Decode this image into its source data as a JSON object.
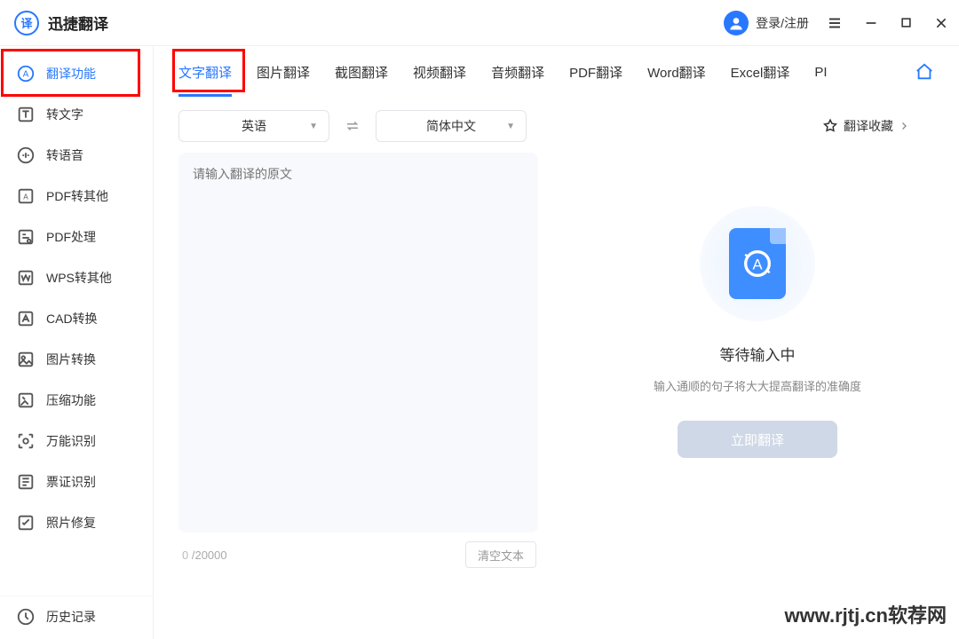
{
  "header": {
    "app_title": "迅捷翻译",
    "login_text": "登录/注册"
  },
  "sidebar": {
    "items": [
      {
        "label": "翻译功能"
      },
      {
        "label": "转文字"
      },
      {
        "label": "转语音"
      },
      {
        "label": "PDF转其他"
      },
      {
        "label": "PDF处理"
      },
      {
        "label": "WPS转其他"
      },
      {
        "label": "CAD转换"
      },
      {
        "label": "图片转换"
      },
      {
        "label": "压缩功能"
      },
      {
        "label": "万能识别"
      },
      {
        "label": "票证识别"
      },
      {
        "label": "照片修复"
      }
    ],
    "history_label": "历史记录"
  },
  "tabs": [
    {
      "label": "文字翻译"
    },
    {
      "label": "图片翻译"
    },
    {
      "label": "截图翻译"
    },
    {
      "label": "视频翻译"
    },
    {
      "label": "音频翻译"
    },
    {
      "label": "PDF翻译"
    },
    {
      "label": "Word翻译"
    },
    {
      "label": "Excel翻译"
    },
    {
      "label": "PI"
    }
  ],
  "langbar": {
    "source_lang": "英语",
    "target_lang": "简体中文",
    "favorites": "翻译收藏"
  },
  "input": {
    "placeholder": "请输入翻译的原文",
    "current_count": "0",
    "max_count": "20000",
    "clear_label": "清空文本"
  },
  "result": {
    "wait_title": "等待输入中",
    "wait_tip": "输入通顺的句子将大大提高翻译的准确度",
    "button": "立即翻译"
  },
  "watermark": "www.rjtj.cn软荐网"
}
